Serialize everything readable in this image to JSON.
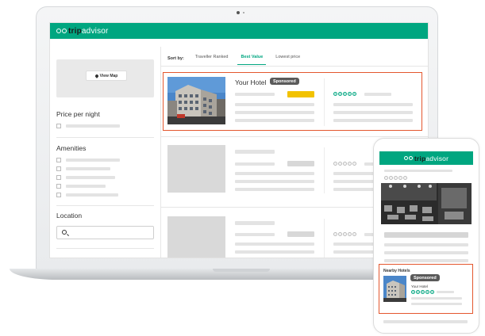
{
  "brand": {
    "name_part1": "trip",
    "name_part2": "advisor",
    "accent": "#00a680",
    "highlight": "#e4572e",
    "sponsored_badge": "#5a5a5a",
    "value_bar": "#f2c200"
  },
  "sidebar": {
    "map_button": "View Map",
    "price_title": "Price per night",
    "amenities_title": "Amenities",
    "location_title": "Location",
    "location_placeholder": ""
  },
  "sort": {
    "label": "Sort by:",
    "tabs": [
      {
        "label": "Traveller Ranked",
        "active": false
      },
      {
        "label": "Best Value",
        "active": true
      },
      {
        "label": "Lowest price",
        "active": false
      }
    ]
  },
  "featured_listing": {
    "name": "Your Hotel",
    "badge": "Sponsored",
    "rating_bubbles": 5
  },
  "phone": {
    "section_title": "Nearby Hotels",
    "badge": "Sponsored",
    "hotel_name": "Your Hotel",
    "rating_bubbles": 5
  },
  "icons": {
    "map_pin": "map-pin-icon",
    "search": "search-icon",
    "logo": "owl-logo-icon"
  }
}
